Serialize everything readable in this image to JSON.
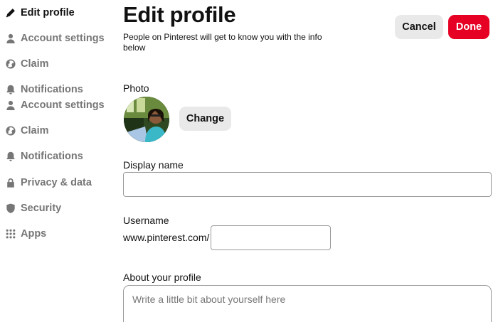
{
  "sidebar": {
    "items": [
      {
        "label": "Edit profile",
        "icon": "pencil-icon"
      },
      {
        "label": "Account settings",
        "icon": "person-icon"
      },
      {
        "label": "Claim",
        "icon": "globe-icon"
      },
      {
        "label": "Notifications",
        "icon": "bell-icon"
      },
      {
        "label": "Account settings",
        "icon": "person-icon"
      },
      {
        "label": "Claim",
        "icon": "globe-icon"
      },
      {
        "label": "Notifications",
        "icon": "bell-icon"
      },
      {
        "label": "Privacy & data",
        "icon": "lock-icon"
      },
      {
        "label": "Security",
        "icon": "shield-icon"
      },
      {
        "label": "Apps",
        "icon": "apps-grid-icon"
      }
    ]
  },
  "header": {
    "title": "Edit profile",
    "subtitle": "People on Pinterest will get to know you with the info below",
    "cancel_label": "Cancel",
    "done_label": "Done"
  },
  "form": {
    "photo_label": "Photo",
    "change_label": "Change",
    "display_name_label": "Display name",
    "display_name_value": "",
    "username_label": "Username",
    "username_prefix": "www.pinterest.com/",
    "username_value": "",
    "about_label": "About your profile",
    "about_placeholder": "Write a little bit about yourself here"
  },
  "colors": {
    "brand_red": "#e60023",
    "button_gray": "#e9e9e9",
    "muted_text": "#767676"
  }
}
